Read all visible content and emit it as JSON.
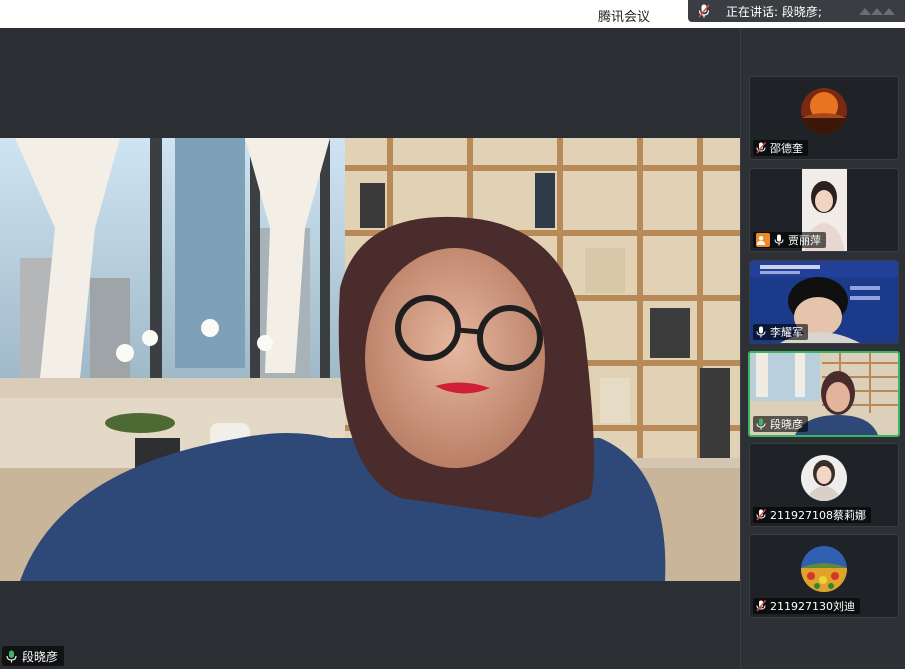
{
  "titlebar": {
    "app_title": "腾讯会议",
    "speaking_label": "正在讲话: 段晓彦;"
  },
  "main": {
    "speaker_name": "段晓彦"
  },
  "participants": [
    {
      "name": "邵德奎",
      "mic": "muted",
      "avatar": "sunset-avatar"
    },
    {
      "name": "贾丽萍",
      "mic": "on",
      "avatar": "portrait-avatar",
      "badge": "host-icon"
    },
    {
      "name": "李耀军",
      "mic": "on",
      "avatar": "video-feed"
    },
    {
      "name": "段晓彦",
      "mic": "on",
      "avatar": "video-feed",
      "active": true
    },
    {
      "name": "211927108蔡莉娜",
      "mic": "muted",
      "avatar": "portrait-avatar"
    },
    {
      "name": "211927130刘迪",
      "mic": "muted",
      "avatar": "painting-avatar"
    }
  ],
  "colors": {
    "active_border": "#3bb75e",
    "mic_on": "#3bb75e",
    "mic_muted": "#e04a3a",
    "host_badge": "#f08a24"
  }
}
